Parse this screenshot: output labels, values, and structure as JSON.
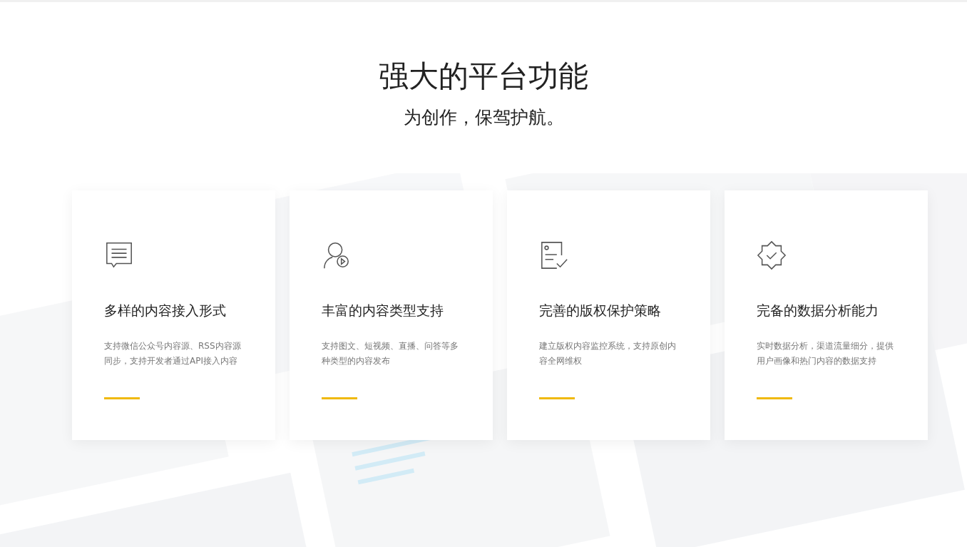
{
  "heading": {
    "title": "强大的平台功能",
    "subtitle": "为创作，保驾护航。"
  },
  "features": [
    {
      "kind": "chat",
      "title": "多样的内容接入形式",
      "description": "支持微信公众号内容源、RSS内容源同步，支持开发者通过API接入内容"
    },
    {
      "kind": "user-play",
      "title": "丰富的内容类型支持",
      "description": "支持图文、短视频、直播、问答等多种类型的内容发布"
    },
    {
      "kind": "document-check",
      "title": "完善的版权保护策略",
      "description": "建立版权内容监控系统，支持原创内容全网维权"
    },
    {
      "kind": "badge-check",
      "title": "完备的数据分析能力",
      "description": "实时数据分析，渠道流量细分，提供用户画像和热门内容的数据支持"
    }
  ]
}
